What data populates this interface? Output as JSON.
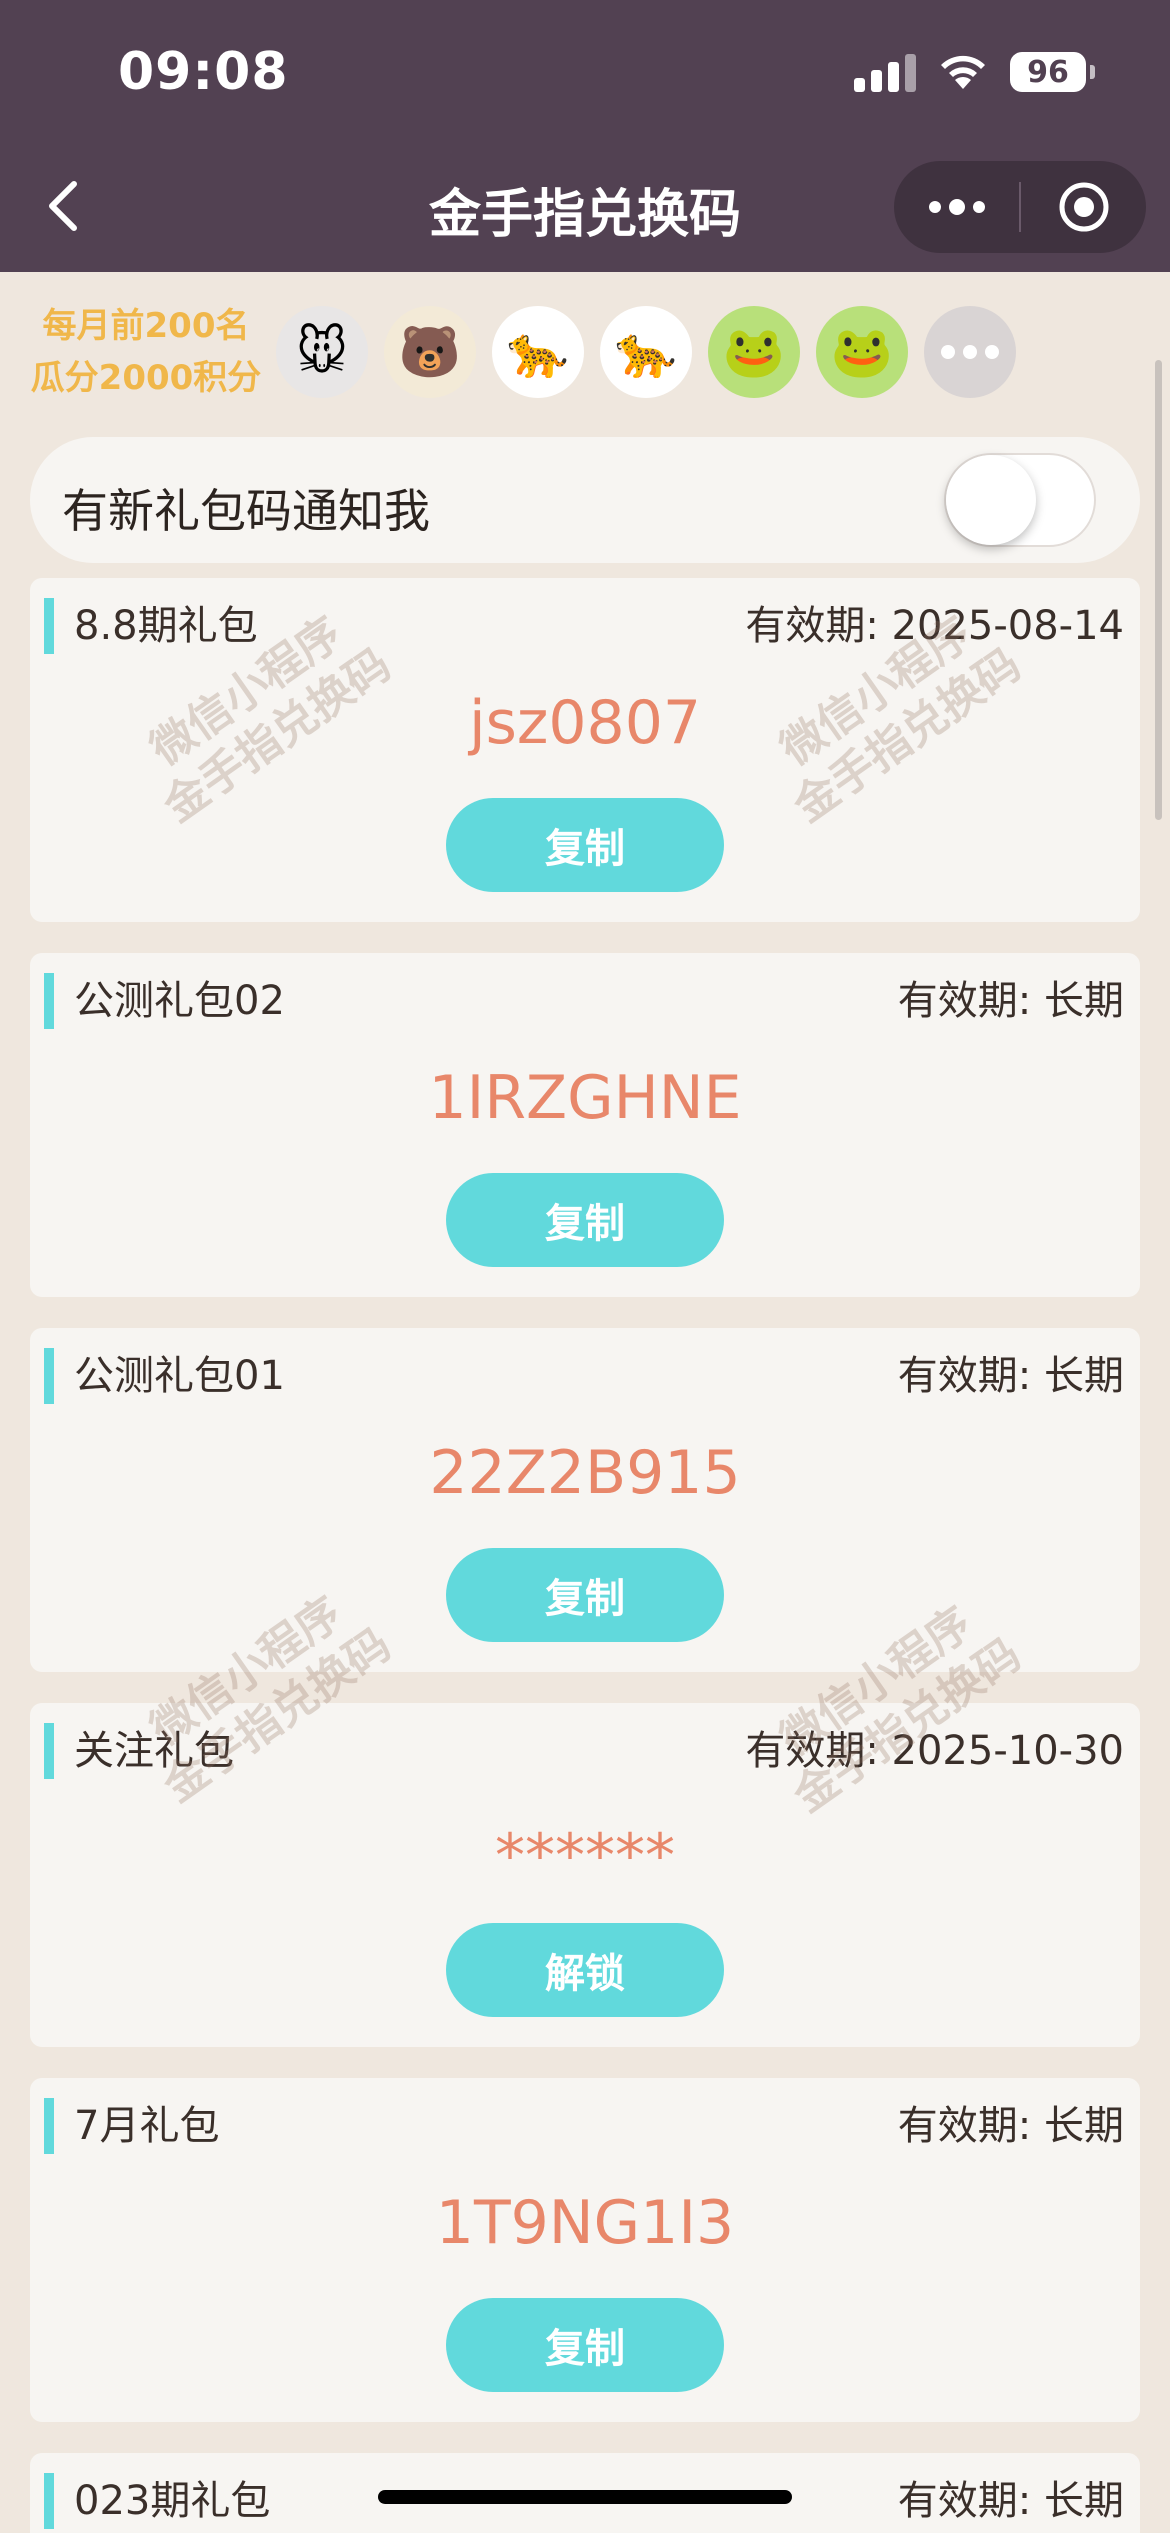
{
  "status_bar": {
    "time": "09:08",
    "battery": "96"
  },
  "nav": {
    "title": "金手指兑换码",
    "back_icon": "chevron-left-icon",
    "more_icon": "more-dots-icon",
    "close_icon": "target-circle-icon"
  },
  "ranking": {
    "line1": "每月前200名",
    "line2": "瓜分2000积分",
    "avatars": [
      "🐭",
      "🐻",
      "🐆",
      "🐆",
      "🐸",
      "🐸"
    ]
  },
  "notify": {
    "label": "有新礼包码通知我",
    "enabled": false
  },
  "gifts": [
    {
      "name": "8.8期礼包",
      "expiry": "有效期: 2025-08-14",
      "code": "jsz0807",
      "action": "复制"
    },
    {
      "name": "公测礼包02",
      "expiry": "有效期: 长期",
      "code": "1IRZGHNE",
      "action": "复制"
    },
    {
      "name": "公测礼包01",
      "expiry": "有效期: 长期",
      "code": "22Z2B915",
      "action": "复制"
    },
    {
      "name": "关注礼包",
      "expiry": "有效期: 2025-10-30",
      "code": "******",
      "action": "解锁"
    },
    {
      "name": "7月礼包",
      "expiry": "有效期: 长期",
      "code": "1T9NG1I3",
      "action": "复制"
    },
    {
      "name": "023期礼包",
      "expiry": "有效期: 长期"
    }
  ],
  "watermark": {
    "line1": "微信小程序",
    "line2": "金手指兑换码"
  },
  "colors": {
    "header": "#524152",
    "accent": "#61d9dc",
    "code": "#e8876a",
    "rank_text": "#f0b74a",
    "background": "#efe7de"
  }
}
